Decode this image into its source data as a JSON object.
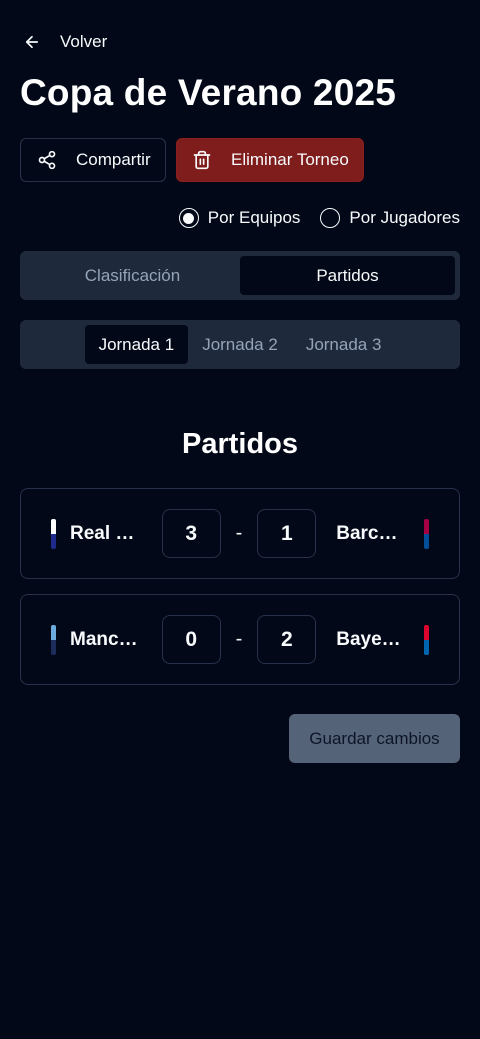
{
  "nav": {
    "back_label": "Volver"
  },
  "tournament": {
    "title": "Copa de Verano 2025"
  },
  "actions": {
    "share_label": "Compartir",
    "delete_label": "Eliminar Torneo"
  },
  "mode": {
    "options": [
      {
        "label": "Por Equipos",
        "selected": true
      },
      {
        "label": "Por Jugadores",
        "selected": false
      }
    ]
  },
  "tabs": [
    {
      "label": "Clasificación",
      "active": false
    },
    {
      "label": "Partidos",
      "active": true
    }
  ],
  "jornadas": [
    {
      "label": "Jornada 1",
      "active": true
    },
    {
      "label": "Jornada 2",
      "active": false
    },
    {
      "label": "Jornada 3",
      "active": false
    }
  ],
  "section": {
    "title": "Partidos"
  },
  "matches": [
    {
      "home": {
        "name": "Real …",
        "colors": [
          "#ffffff",
          "#1e2a8c"
        ]
      },
      "home_score": "3",
      "separator": "-",
      "away_score": "1",
      "away": {
        "name": "Barc…",
        "colors": [
          "#a50044",
          "#004d98"
        ]
      }
    },
    {
      "home": {
        "name": "Manc…",
        "colors": [
          "#6cabdd",
          "#1c2c5b"
        ]
      },
      "home_score": "0",
      "separator": "-",
      "away_score": "2",
      "away": {
        "name": "Baye…",
        "colors": [
          "#dc052d",
          "#0066b2"
        ]
      }
    }
  ],
  "save": {
    "label": "Guardar cambios"
  },
  "colors": {
    "background": "#020817",
    "danger": "#7f1d1d",
    "muted_surface": "#1e293b",
    "border": "#27324a",
    "disabled_button": "#64748b"
  }
}
